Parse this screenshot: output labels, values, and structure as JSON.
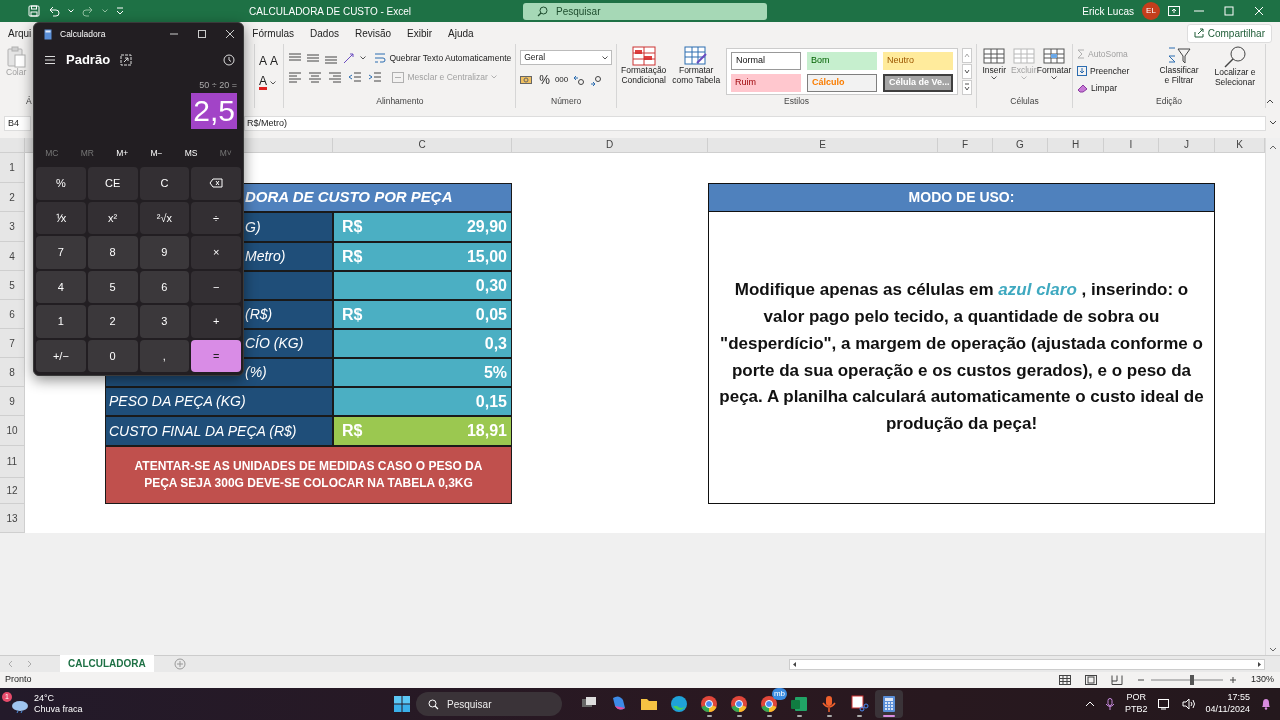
{
  "excel": {
    "title": "CALCULADORA DE CUSTO  -  Excel",
    "search_placeholder": "Pesquisar",
    "user": "Erick Lucas",
    "avatar": "EL",
    "menu_tabs": [
      "Arqui",
      "Fórmulas",
      "Dados",
      "Revisão",
      "Exibir",
      "Ajuda"
    ],
    "share": "Compartilhar",
    "ribbon": {
      "clipboard": {
        "paste": "Colar",
        "group": "Á"
      },
      "font": {
        "grow": "A",
        "shrink": "A",
        "color_button": "A"
      },
      "alignment": {
        "wrap": "Quebrar Texto Automaticamente",
        "merge": "Mesclar e Centralizar",
        "merge_disabled": true,
        "group": "Alinhamento"
      },
      "number": {
        "format": "Geral",
        "percent": "%",
        "thousands": "000",
        "group": "Número"
      },
      "styles": {
        "conditional": "Formatação Condicional",
        "table": "Formatar como Tabela",
        "group": "Estilos",
        "gallery": [
          {
            "label": "Normal",
            "kind": "normal"
          },
          {
            "label": "Bom",
            "kind": "good"
          },
          {
            "label": "Neutro",
            "kind": "neutral"
          },
          {
            "label": "Ruim",
            "kind": "bad"
          },
          {
            "label": "Cálculo",
            "kind": "calc"
          },
          {
            "label": "Célula de Ve...",
            "kind": "check"
          }
        ]
      },
      "cells": {
        "group": "Células",
        "items": [
          {
            "label": "Inserir",
            "disabled": false
          },
          {
            "label": "Excluir",
            "disabled": true
          },
          {
            "label": "Formatar",
            "disabled": false
          }
        ]
      },
      "editing": {
        "autosum": "AutoSoma",
        "autosum_disabled": true,
        "fill": "Preencher",
        "clear": "Limpar",
        "sort": "Classificar e Filtrar",
        "find": "Localizar e Selecionar",
        "group": "Edição"
      }
    },
    "name_box": "B4",
    "formula": "R$/Metro)",
    "columns": [
      "C",
      "D",
      "E",
      "F",
      "G",
      "H",
      "I",
      "J",
      "K"
    ],
    "rows": [
      "1",
      "2",
      "3",
      "4",
      "5",
      "6",
      "7",
      "8",
      "9",
      "10",
      "11",
      "12",
      "13"
    ],
    "cost_table": {
      "header": {
        "text": "DORA DE CUSTO POR PEÇA",
        "covered": true
      },
      "rows": [
        {
          "label": "G)",
          "covered": true,
          "prefix": "R$",
          "value": "29,90",
          "kind": "input"
        },
        {
          "label": "Metro)",
          "covered": true,
          "prefix": "R$",
          "value": "15,00",
          "kind": "input"
        },
        {
          "value": "0,30",
          "kind": "input"
        },
        {
          "label": "(R$)",
          "covered": true,
          "prefix": "R$",
          "value": "0,05",
          "kind": "input"
        },
        {
          "label": "CÍO  (KG)",
          "covered": true,
          "value": "0,3",
          "kind": "input"
        },
        {
          "label": "(%)",
          "covered": true,
          "value": "5%",
          "kind": "input"
        },
        {
          "label": "PESO DA PEÇA  (KG)",
          "covered": false,
          "value": "0,15",
          "kind": "input"
        },
        {
          "label": "CUSTO FINAL DA PEÇA  (R$)",
          "covered": false,
          "prefix": "R$",
          "value": "18,91",
          "kind": "result"
        }
      ],
      "note": "ATENTAR-SE AS UNIDADES DE MEDIDAS CASO O PESO DA PEÇA SEJA 300G DEVE-SE COLOCAR NA TABELA 0,3KG"
    },
    "usage_box": {
      "header": "MODO DE USO:",
      "before": "Modifique apenas as células em ",
      "highlight": "azul claro",
      "after": " ,  inserindo: o valor pago pelo tecido, a quantidade de sobra ou \"desperdício\", a margem de operação (ajustada conforme o porte da sua operação e os custos gerados), e o peso da peça. A planilha calculará automaticamente o custo ideal de produção da peça!"
    },
    "sheet_tabs": [
      {
        "label": "CALCULADORA",
        "selected": true
      }
    ],
    "status": "Pronto",
    "zoom": "130%",
    "zoom_slider": {
      "level": 0.57
    }
  },
  "calculator": {
    "title": "Calculadora",
    "mode": "Padrão",
    "expression": "50 ÷ 20 =",
    "display": "2,5",
    "display_selected": true,
    "memory": [
      {
        "label": "MC",
        "disabled": true
      },
      {
        "label": "MR",
        "disabled": true
      },
      {
        "label": "M+",
        "disabled": false
      },
      {
        "label": "M−",
        "disabled": false
      },
      {
        "label": "MS",
        "disabled": false
      },
      {
        "label": "M˅",
        "disabled": true
      }
    ],
    "keys": [
      {
        "label": "%",
        "kind": "function"
      },
      {
        "label": "CE",
        "kind": "function"
      },
      {
        "label": "C",
        "kind": "function"
      },
      {
        "kind": "backspace"
      },
      {
        "label": "⅟x",
        "kind": "function"
      },
      {
        "label": "x²",
        "kind": "function"
      },
      {
        "label": "²√x",
        "kind": "function"
      },
      {
        "label": "÷",
        "kind": "function"
      },
      {
        "label": "7",
        "kind": "digit"
      },
      {
        "label": "8",
        "kind": "digit"
      },
      {
        "label": "9",
        "kind": "digit"
      },
      {
        "label": "×",
        "kind": "function"
      },
      {
        "label": "4",
        "kind": "digit"
      },
      {
        "label": "5",
        "kind": "digit"
      },
      {
        "label": "6",
        "kind": "digit"
      },
      {
        "label": "−",
        "kind": "function"
      },
      {
        "label": "1",
        "kind": "digit"
      },
      {
        "label": "2",
        "kind": "digit"
      },
      {
        "label": "3",
        "kind": "digit"
      },
      {
        "label": "+",
        "kind": "function"
      },
      {
        "label": "+/−",
        "kind": "digit"
      },
      {
        "label": "0",
        "kind": "digit"
      },
      {
        "label": ",",
        "kind": "digit"
      },
      {
        "label": "=",
        "kind": "equals"
      }
    ]
  },
  "taskbar": {
    "weather": {
      "badge": "1",
      "temp": "24°C",
      "desc": "Chuva fraca"
    },
    "search_placeholder": "Pesquisar",
    "apps": [
      {
        "kind": "taskview",
        "running": false,
        "selected": false
      },
      {
        "kind": "copilot",
        "running": false,
        "selected": false
      },
      {
        "kind": "folder",
        "running": false,
        "selected": false
      },
      {
        "kind": "edge",
        "running": false,
        "selected": false
      },
      {
        "kind": "chrome",
        "running": true,
        "selected": false
      },
      {
        "kind": "chrome",
        "running": true,
        "selected": false
      },
      {
        "kind": "chrome",
        "running": true,
        "selected": false,
        "badge": "mb"
      },
      {
        "kind": "excel",
        "running": true,
        "selected": false
      },
      {
        "kind": "recorder",
        "running": true,
        "selected": false
      },
      {
        "kind": "snip",
        "running": true,
        "selected": false
      },
      {
        "kind": "calculator",
        "running": true,
        "selected": true
      }
    ],
    "lang": "POR",
    "layout": "PTB2",
    "time": "17:55",
    "date": "04/11/2024"
  }
}
